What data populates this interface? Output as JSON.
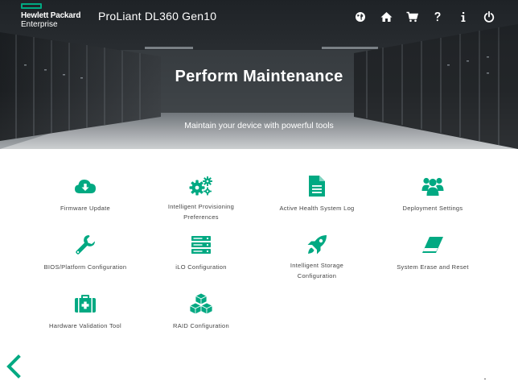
{
  "brand": {
    "line1": "Hewlett Packard",
    "line2": "Enterprise",
    "accent": "#01a982"
  },
  "header": {
    "product": "ProLiant DL360 Gen10",
    "icons": [
      "globe-icon",
      "home-icon",
      "cart-icon",
      "help-icon",
      "info-icon",
      "power-icon"
    ]
  },
  "hero": {
    "title": "Perform Maintenance",
    "subtitle": "Maintain your device with powerful tools"
  },
  "tiles": [
    {
      "label": "Firmware Update",
      "icon": "cloud-download-icon"
    },
    {
      "label": "Intelligent Provisioning Preferences",
      "icon": "gears-icon"
    },
    {
      "label": "Active Health System Log",
      "icon": "document-icon"
    },
    {
      "label": "Deployment Settings",
      "icon": "users-icon"
    },
    {
      "label": "BIOS/Platform Configuration",
      "icon": "wrench-icon"
    },
    {
      "label": "iLO Configuration",
      "icon": "server-icon"
    },
    {
      "label": "Intelligent Storage Configuration",
      "icon": "rocket-icon"
    },
    {
      "label": "System Erase and Reset",
      "icon": "eraser-icon"
    },
    {
      "label": "Hardware Validation Tool",
      "icon": "medkit-icon"
    },
    {
      "label": "RAID Configuration",
      "icon": "cubes-icon"
    }
  ],
  "tiles_multiline": {
    "ip_line1": "Intelligent Provisioning",
    "ip_line2": "Preferences",
    "is_line1": "Intelligent Storage",
    "is_line2": "Configuration"
  },
  "nav": {
    "back": "chevron-left-icon"
  }
}
